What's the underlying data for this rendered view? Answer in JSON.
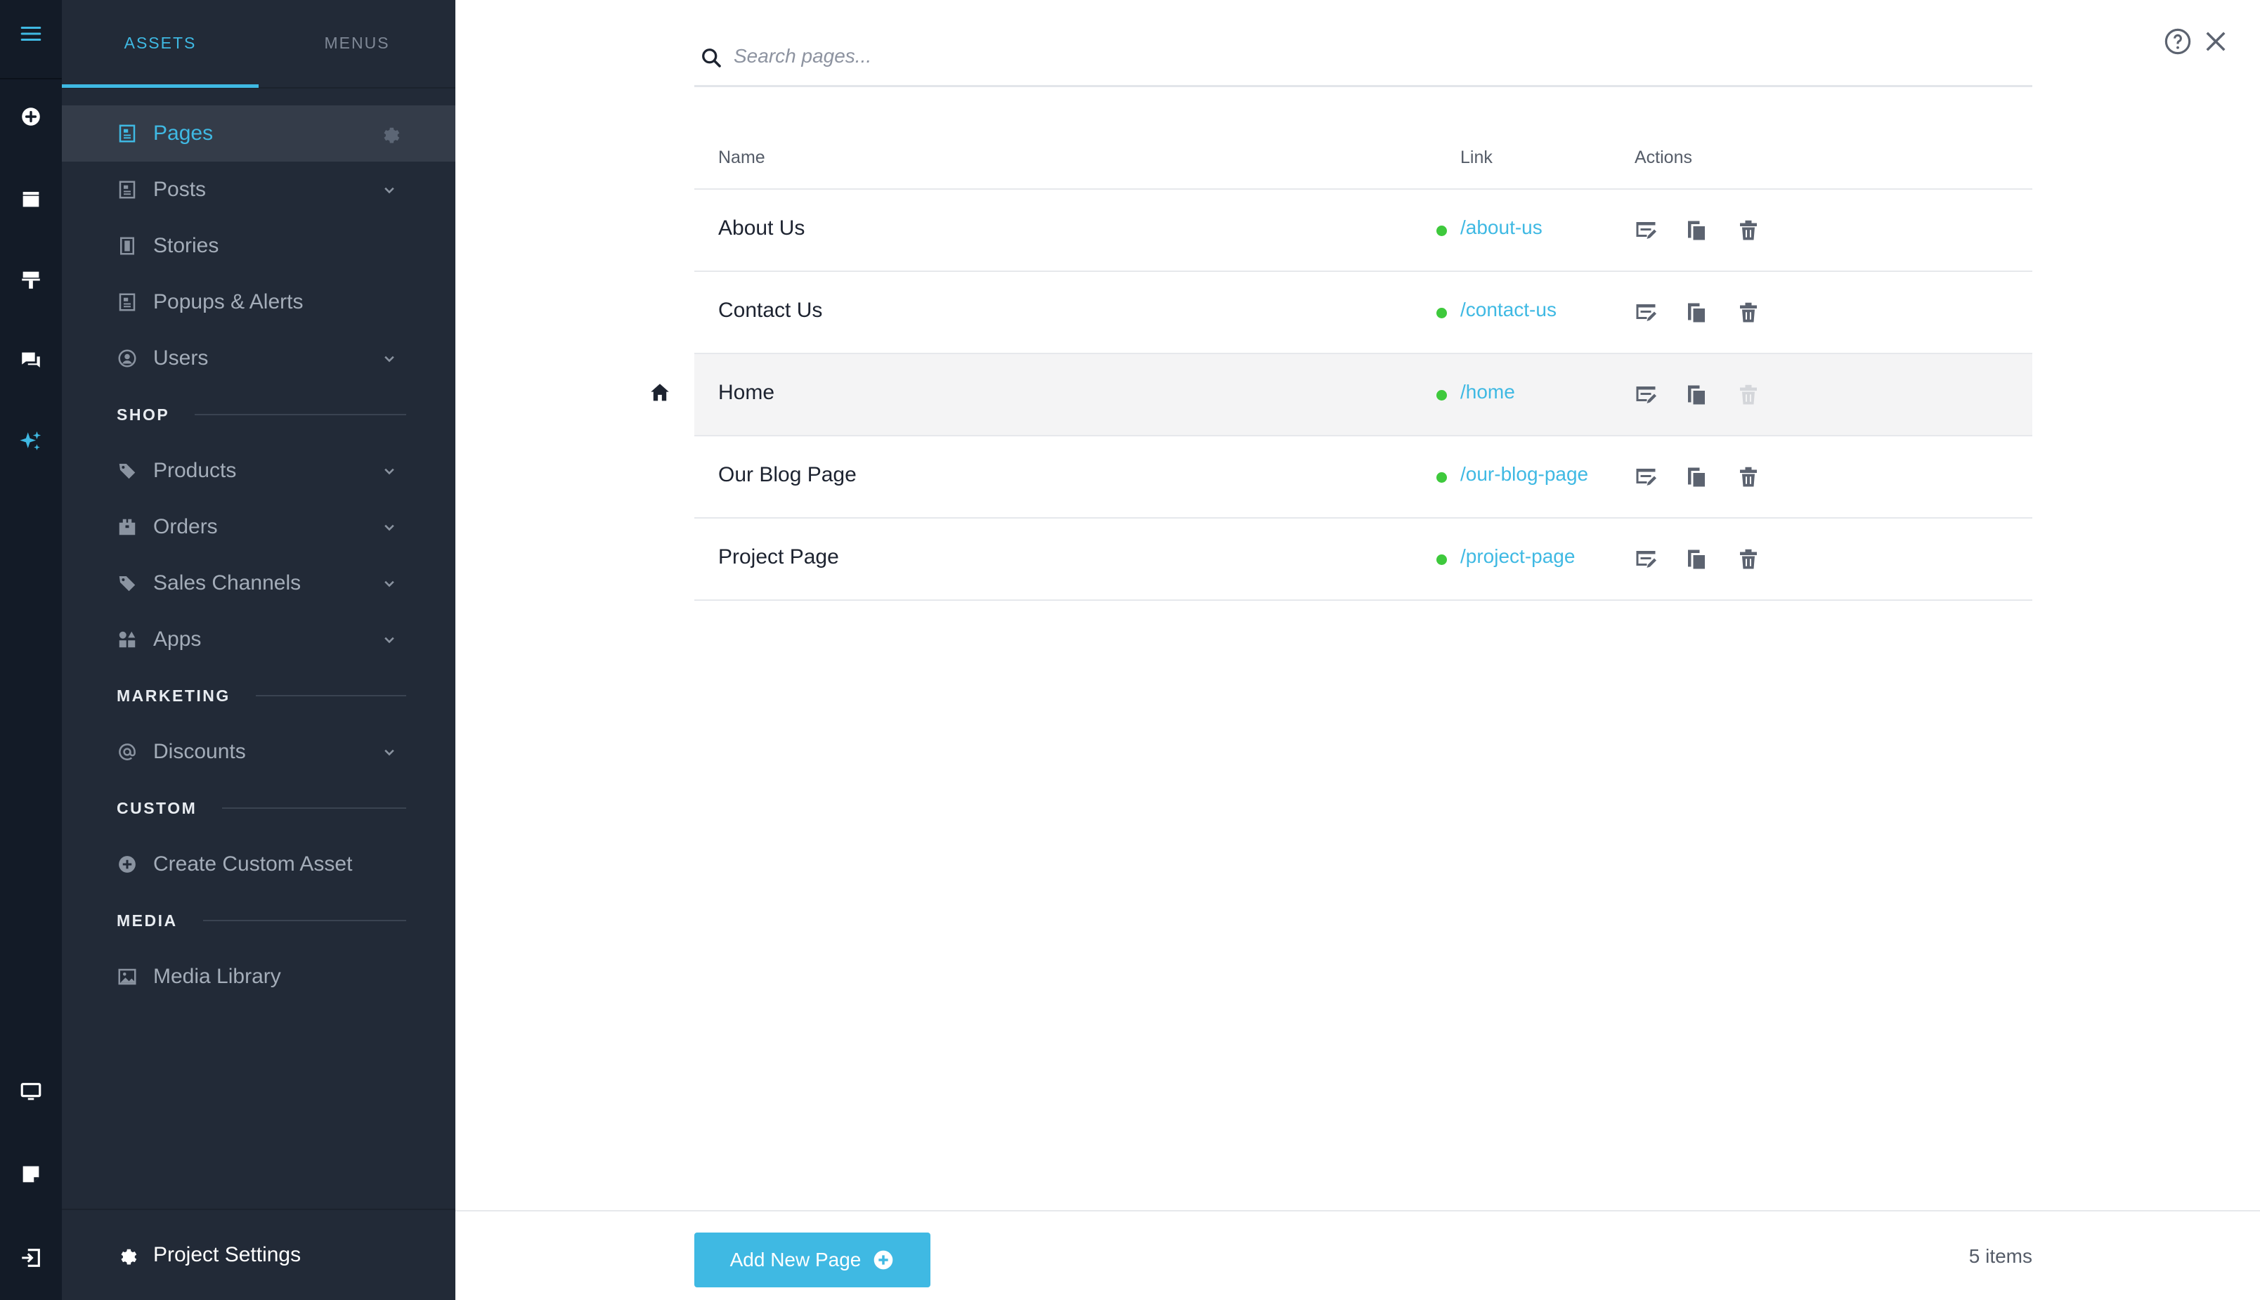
{
  "sidebar": {
    "tabs": [
      {
        "label": "ASSETS",
        "active": true
      },
      {
        "label": "MENUS",
        "active": false
      }
    ],
    "items": [
      {
        "label": "Pages",
        "icon": "page-icon",
        "active": true
      },
      {
        "label": "Posts",
        "icon": "page-icon",
        "expandable": true
      },
      {
        "label": "Stories",
        "icon": "book-icon"
      },
      {
        "label": "Popups & Alerts",
        "icon": "page-icon"
      },
      {
        "label": "Users",
        "icon": "user-circle-icon",
        "expandable": true
      }
    ],
    "sections": {
      "shop": "SHOP",
      "marketing": "MARKETING",
      "custom": "CUSTOM",
      "media": "MEDIA"
    },
    "shop_items": [
      {
        "label": "Products",
        "icon": "tag-icon",
        "expandable": true
      },
      {
        "label": "Orders",
        "icon": "box-icon",
        "expandable": true
      },
      {
        "label": "Sales Channels",
        "icon": "tag-icon",
        "expandable": true
      },
      {
        "label": "Apps",
        "icon": "apps-icon",
        "expandable": true
      }
    ],
    "marketing_items": [
      {
        "label": "Discounts",
        "icon": "at-icon",
        "expandable": true
      }
    ],
    "custom_items": [
      {
        "label": "Create Custom Asset",
        "icon": "plus-circle-icon"
      }
    ],
    "media_items": [
      {
        "label": "Media Library",
        "icon": "image-icon"
      }
    ],
    "project_settings": "Project Settings"
  },
  "search": {
    "placeholder": "Search pages...",
    "value": ""
  },
  "table": {
    "headers": {
      "name": "Name",
      "link": "Link",
      "actions": "Actions"
    },
    "rows": [
      {
        "name": "About Us",
        "link": "/about-us",
        "status": "published",
        "is_home": false
      },
      {
        "name": "Contact Us",
        "link": "/contact-us",
        "status": "published",
        "is_home": false
      },
      {
        "name": "Home",
        "link": "/home",
        "status": "published",
        "is_home": true
      },
      {
        "name": "Our Blog Page",
        "link": "/our-blog-page",
        "status": "published",
        "is_home": false
      },
      {
        "name": "Project Page",
        "link": "/project-page",
        "status": "published",
        "is_home": false
      }
    ]
  },
  "footer": {
    "add_button": "Add New Page",
    "items_count": "5 items"
  },
  "colors": {
    "accent": "#3fb9e3",
    "rail_bg": "#131b27",
    "sidebar_bg": "#222a37",
    "status_green": "#3ec93c"
  }
}
